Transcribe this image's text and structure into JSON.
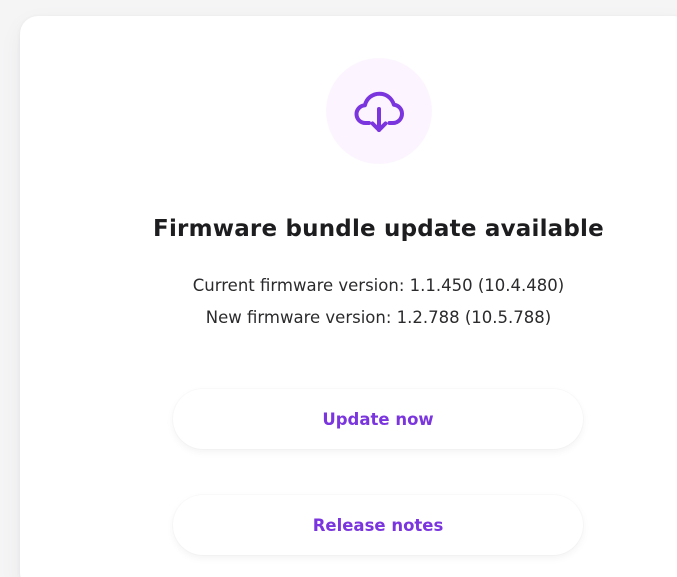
{
  "dialog": {
    "icon": "cloud-download-icon",
    "accent_color": "#7b35de",
    "icon_background": "#fcf5ff",
    "title": "Firmware bundle update available",
    "current_version_text": "Current firmware version: 1.1.450 (10.4.480)",
    "new_version_text": "New firmware version: 1.2.788 (10.5.788)"
  },
  "actions": {
    "update_label": "Update now",
    "release_notes_label": "Release notes"
  }
}
